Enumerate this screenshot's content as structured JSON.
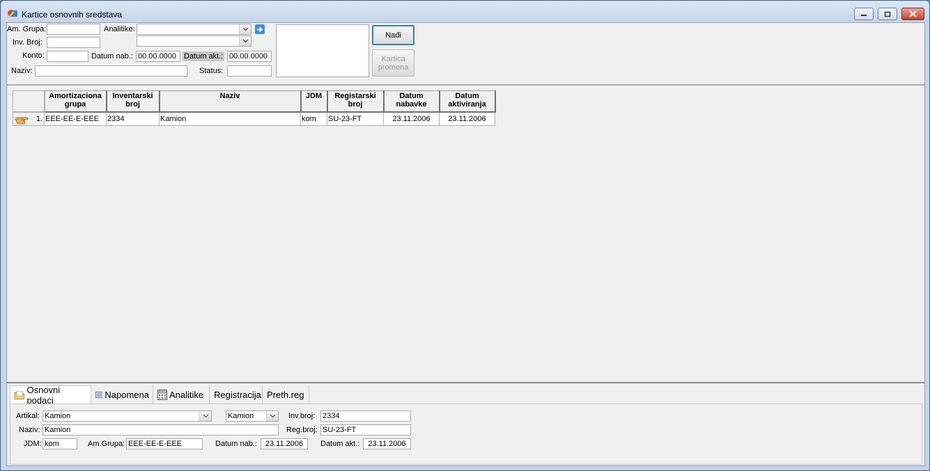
{
  "window": {
    "title": "Kartice osnovnih sredstava"
  },
  "filters": {
    "am_grupa_label": "Am. Grupa:",
    "am_grupa_value": "",
    "analitike_label": "Analitike:",
    "analitike_value_1": "",
    "analitike_value_2": "",
    "inv_broj_label": "Inv. Broj:",
    "inv_broj_value": "",
    "konto_label": "Konto:",
    "konto_value": "",
    "datum_nab_label": "Datum nab.:",
    "datum_nab_value": "00.00.0000",
    "datum_akt_label": "Datum akt.:",
    "datum_akt_value": "00.00.0000",
    "naziv_label": "Naziv:",
    "naziv_value": "",
    "status_label": "Status:",
    "status_value": ""
  },
  "buttons": {
    "nadji": "Nađi",
    "kartica_promena": "Kartica promena"
  },
  "grid": {
    "headers": [
      "Amortizaciona grupa",
      "Inventarski broj",
      "Naziv",
      "JDM",
      "Registarski broj",
      "Datum nabavke",
      "Datum aktiviranja"
    ],
    "rows": [
      {
        "num": "1.",
        "am_grupa": "EEE-EE-E-EEE",
        "inv_broj": "2334",
        "naziv": "Kamion",
        "jdm": "kom",
        "reg_broj": "SU-23-FT",
        "datum_nab": "23.11.2006",
        "datum_akt": "23.11.2006"
      }
    ]
  },
  "tabs": [
    {
      "label": "Osnovni podaci",
      "icon": "folder-icon",
      "active": true
    },
    {
      "label": "Napomena",
      "icon": "notes-icon"
    },
    {
      "label": "Analitike",
      "icon": "calculator-icon"
    },
    {
      "label": "Registracija"
    },
    {
      "label": "Preth.reg"
    }
  ],
  "detail": {
    "artikal_label": "Artikal:",
    "artikal_value": "Kamion",
    "artikal_value2": "Kamion",
    "inv_broj_label": "Inv.broj:",
    "inv_broj_value": "2334",
    "naziv_label": "Naziv:",
    "naziv_value": "Kamion",
    "reg_broj_label": "Reg.broj:",
    "reg_broj_value": "SU-23-FT",
    "jdm_label": "JDM:",
    "jdm_value": "kom",
    "am_grupa_label": "Am.Grupa:",
    "am_grupa_value": "EEE-EE-E-EEE",
    "datum_nab_label": "Datum nab.:",
    "datum_nab_value": "23.11.2006",
    "datum_akt_label": "Datum akt.:",
    "datum_akt_value": "23.11.2006"
  }
}
